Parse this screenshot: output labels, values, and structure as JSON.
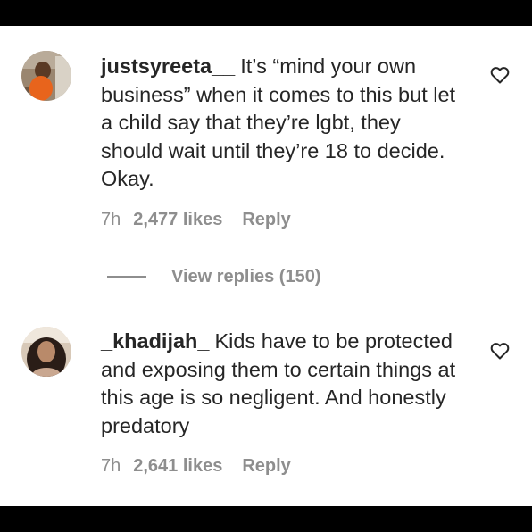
{
  "comments": [
    {
      "username": "justsyreeta__",
      "text": "It’s “mind your own business” when it comes to this but let a child say that they’re lgbt, they should wait until they’re 18 to decide. Okay.",
      "time": "7h",
      "likes": "2,477 likes",
      "reply_label": "Reply",
      "avatar_icon": "user-avatar-photo",
      "like_icon": "heart-outline-icon"
    },
    {
      "username": "_khadijah_",
      "text": "Kids have to be protected and exposing them to certain things at this age is so negligent. And honestly predatory",
      "time": "7h",
      "likes": "2,641 likes",
      "reply_label": "Reply",
      "avatar_icon": "user-avatar-photo",
      "like_icon": "heart-outline-icon"
    }
  ],
  "view_replies": {
    "label": "View replies (150)"
  }
}
